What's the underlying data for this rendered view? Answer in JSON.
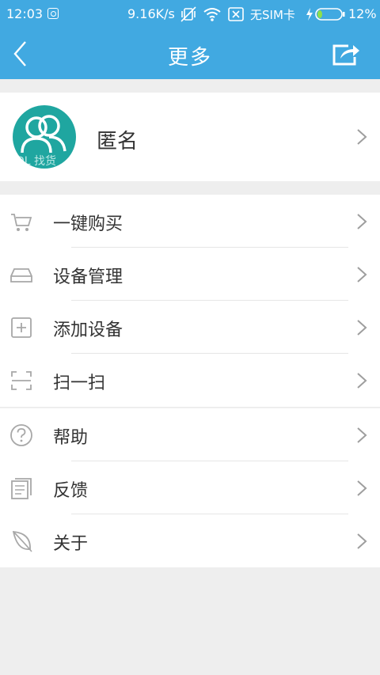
{
  "status_bar": {
    "time": "12:03",
    "speed": "9.16K/s",
    "sim": "无SIM卡",
    "battery": "12%"
  },
  "header": {
    "title": "更多"
  },
  "profile": {
    "name": "匿名",
    "avatar_watermark": "DL 找货"
  },
  "menu_group_1": [
    {
      "label": "一键购买",
      "icon": "cart-icon"
    },
    {
      "label": "设备管理",
      "icon": "device-icon"
    },
    {
      "label": "添加设备",
      "icon": "add-device-icon"
    },
    {
      "label": "扫一扫",
      "icon": "scan-icon"
    }
  ],
  "menu_group_2": [
    {
      "label": "帮助",
      "icon": "help-icon"
    },
    {
      "label": "反馈",
      "icon": "feedback-icon"
    },
    {
      "label": "关于",
      "icon": "leaf-icon"
    }
  ],
  "colors": {
    "accent": "#41a9e1",
    "avatar": "#1fa6a0",
    "background": "#eeeeee",
    "icon_gray": "#9e9e9e"
  }
}
